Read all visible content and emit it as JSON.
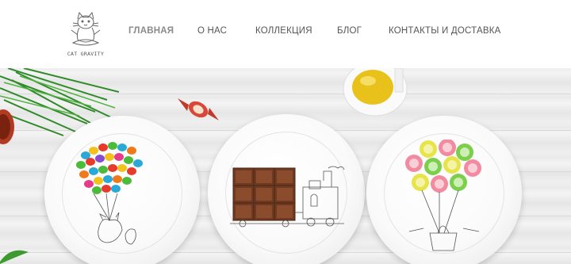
{
  "logo": {
    "text": "CAT GRAVITY",
    "icon": "cat-yoga-icon"
  },
  "nav": {
    "items": [
      {
        "label": "ГЛАВНАЯ",
        "active": true
      },
      {
        "label": "О НАС",
        "active": false
      },
      {
        "label": "КОЛЛЕКЦИЯ",
        "active": false
      },
      {
        "label": "БЛОГ",
        "active": false
      },
      {
        "label": "КОНТАКТЫ И ДОСТАВКА",
        "active": false
      }
    ]
  },
  "colors": {
    "nav_text": "#555555",
    "nav_active": "#8a8a8a",
    "table": "#ececec"
  }
}
